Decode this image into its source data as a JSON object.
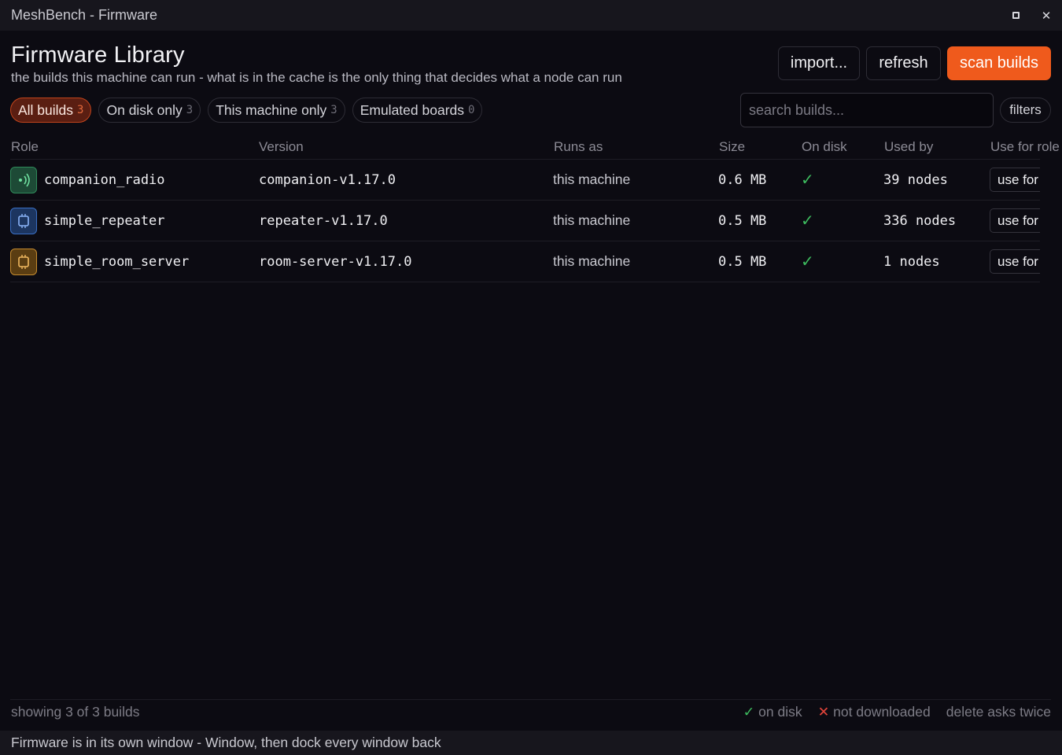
{
  "window": {
    "title": "MeshBench - Firmware"
  },
  "header": {
    "title": "Firmware Library",
    "subtitle": "the builds this machine can run - what is in the cache is the only thing that decides what a node can run",
    "import_label": "import...",
    "refresh_label": "refresh",
    "scan_label": "scan builds"
  },
  "chips": [
    {
      "label": "All builds",
      "count": "3",
      "active": true
    },
    {
      "label": "On disk only",
      "count": "3"
    },
    {
      "label": "This machine only",
      "count": "3"
    },
    {
      "label": "Emulated boards",
      "count": "0"
    }
  ],
  "search": {
    "placeholder": "search builds..."
  },
  "filters_label": "filters",
  "table": {
    "headers": {
      "role": "Role",
      "version": "Version",
      "runs_as": "Runs as",
      "size": "Size",
      "on_disk": "On disk",
      "used_by": "Used by",
      "use_for": "Use for role"
    },
    "rows": [
      {
        "role": "companion_radio",
        "version": "companion-v1.17.0",
        "runs_as": "this machine",
        "size": "0.6 MB",
        "on_disk": "✓",
        "used_by": "39 nodes",
        "action": "use for",
        "icon": "radio-wave-icon",
        "color": "#2f8a5a"
      },
      {
        "role": "simple_repeater",
        "version": "repeater-v1.17.0",
        "runs_as": "this machine",
        "size": "0.5 MB",
        "on_disk": "✓",
        "used_by": "336 nodes",
        "action": "use for",
        "icon": "chip-icon",
        "color": "#3a6fc4"
      },
      {
        "role": "simple_room_server",
        "version": "room-server-v1.17.0",
        "runs_as": "this machine",
        "size": "0.5 MB",
        "on_disk": "✓",
        "used_by": "1 nodes",
        "action": "use for",
        "icon": "chip-icon",
        "color": "#c48a2e"
      }
    ]
  },
  "footer": {
    "showing": "showing 3 of 3 builds",
    "legend_on_disk": "on disk",
    "legend_not_downloaded": "not downloaded",
    "legend_delete": "delete asks twice",
    "check_glyph": "✓",
    "x_glyph": "✕"
  },
  "status": {
    "text": "Firmware is in its own window - Window, then dock every window back"
  },
  "colors": {
    "accent": "#ef5a1c",
    "ok": "#3dbb5e",
    "error": "#e0443a",
    "background": "#0c0b12"
  }
}
